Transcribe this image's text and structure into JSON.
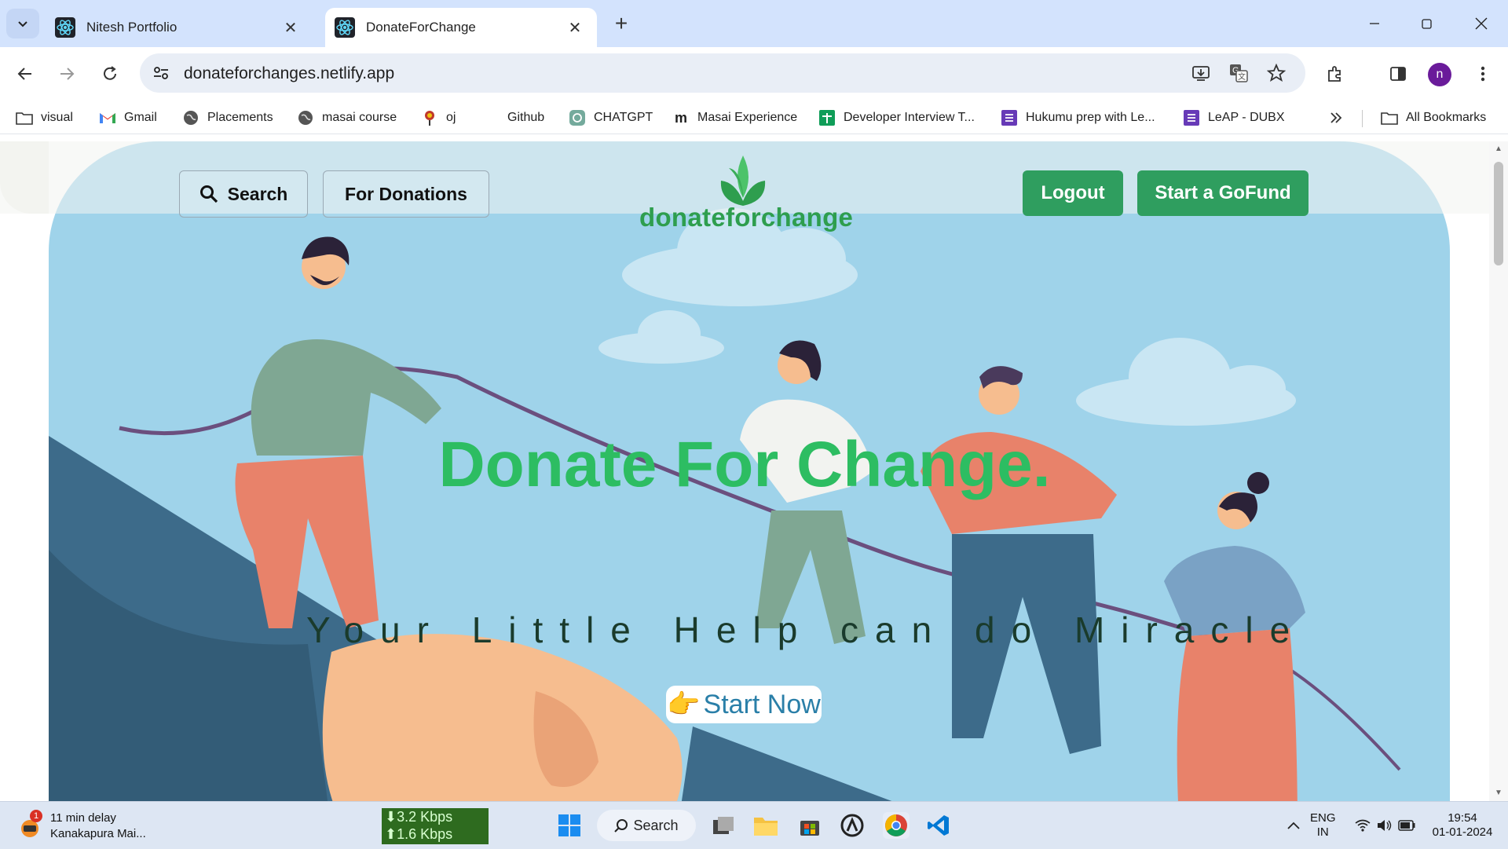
{
  "browser": {
    "tabs": [
      {
        "title": "Nitesh Portfolio",
        "active": false
      },
      {
        "title": "DonateForChange",
        "active": true
      }
    ],
    "url": "donateforchanges.netlify.app",
    "profile_initial": "n",
    "bookmarks": [
      {
        "label": "visual",
        "icon": "folder-icon"
      },
      {
        "label": "Gmail",
        "icon": "gmail-icon"
      },
      {
        "label": "Placements",
        "icon": "globe-icon"
      },
      {
        "label": "masai course",
        "icon": "globe-icon"
      },
      {
        "label": "oj",
        "icon": "oj-icon"
      },
      {
        "label": "Github",
        "icon": "github-icon"
      },
      {
        "label": "CHATGPT",
        "icon": "chatgpt-icon"
      },
      {
        "label": "Masai Experience",
        "icon": "masai-icon"
      },
      {
        "label": "Developer Interview T...",
        "icon": "sheets-icon"
      },
      {
        "label": "Hukumu prep with Le...",
        "icon": "forms-icon"
      },
      {
        "label": "LeAP - DUBX",
        "icon": "forms-icon"
      }
    ],
    "all_bookmarks": "All Bookmarks"
  },
  "site": {
    "nav": {
      "search": "Search",
      "donations": "For Donations",
      "logout": "Logout",
      "gofund": "Start a GoFund"
    },
    "logo_text": "donateforchange",
    "headline": "Donate For Change.",
    "tagline": "Your Little Help can do Miracle",
    "cta": "Start Now",
    "cta_emoji": "👉"
  },
  "taskbar": {
    "weather_line1": "11 min delay",
    "weather_line2": "Kanakapura Mai...",
    "weather_badge": "1",
    "net_down": "⬇3.2 Kbps",
    "net_up": "⬆1.6 Kbps",
    "search": "Search",
    "lang_line1": "ENG",
    "lang_line2": "IN",
    "time": "19:54",
    "date": "01-01-2024"
  },
  "colors": {
    "accent_green": "#2f9e5f",
    "headline_green": "#2dbd62",
    "sky": "#9fd3ea"
  }
}
